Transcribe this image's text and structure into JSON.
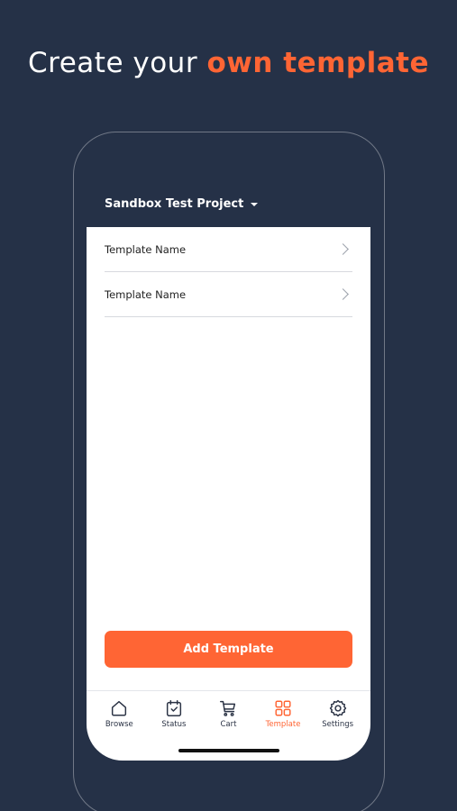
{
  "headline": {
    "plain": "Create your",
    "accent": "own template"
  },
  "project": {
    "name": "Sandbox Test Project"
  },
  "templates": [
    {
      "label": "Template Name"
    },
    {
      "label": "Template Name"
    }
  ],
  "add_button": {
    "label": "Add Template"
  },
  "tabbar": {
    "active_tab": "Template",
    "tabs": [
      {
        "label": "Browse",
        "icon": "home-icon"
      },
      {
        "label": "Status",
        "icon": "calendar-check-icon"
      },
      {
        "label": "Cart",
        "icon": "cart-icon"
      },
      {
        "label": "Template",
        "icon": "grid-icon"
      },
      {
        "label": "Settings",
        "icon": "gear-icon"
      }
    ]
  },
  "colors": {
    "background": "#253147",
    "accent": "#ff6534",
    "screen": "#ffffff"
  }
}
